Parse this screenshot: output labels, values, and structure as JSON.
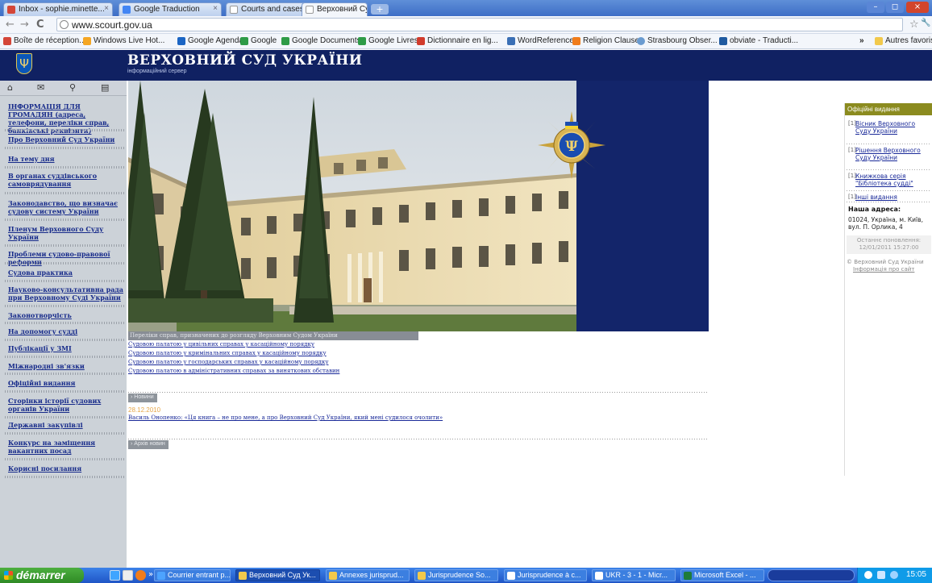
{
  "browser": {
    "tabs": [
      {
        "title": "Inbox - sophie.minette...",
        "icon_color": "#d44638",
        "icon": "gmail-icon"
      },
      {
        "title": "Google Traduction",
        "icon_color": "#4285f4",
        "icon": "translate-icon"
      },
      {
        "title": "Courts and cases Ukrai...",
        "icon_color": "#ffffff",
        "icon": "page-icon"
      },
      {
        "title": "Верховний Суд України",
        "icon_color": "#ffffff",
        "icon": "page-icon"
      }
    ],
    "close_glyph": "×",
    "newtab_glyph": "+",
    "window_buttons": {
      "minimize": "–",
      "maximize": "◻",
      "close": "×"
    },
    "nav": {
      "back": "←",
      "forward": "→",
      "reload": "C"
    },
    "url": "www.scourt.gov.ua",
    "star": "☆",
    "wrench": "🔧",
    "bookmarks": [
      {
        "label": "Boîte de réception...",
        "icon_color": "#d44638"
      },
      {
        "label": "Windows Live Hot...",
        "icon_color": "#f5a623"
      },
      {
        "label": "Google Agenda",
        "icon_color": "#1b65c4"
      },
      {
        "label": "Google",
        "icon_color": "#2e9b47"
      },
      {
        "label": "Google Documents",
        "icon_color": "#2e9b47"
      },
      {
        "label": "Google Livres",
        "icon_color": "#2e9b47"
      },
      {
        "label": "Dictionnaire en lig...",
        "icon_color": "#d13b2c"
      },
      {
        "label": "WordReference",
        "icon_color": "#3a6fb5"
      },
      {
        "label": "Religion Clause",
        "icon_color": "#f07c1b"
      },
      {
        "label": "Strasbourg Obser...",
        "icon_color": "#6a9bd0"
      },
      {
        "label": "obviate - Traducti...",
        "icon_color": "#1f5aa0"
      }
    ],
    "bookmarks_more": "»",
    "other_bookmarks": "Autres favoris"
  },
  "site": {
    "title": "ВЕРХОВНИЙ СУД УКРАЇНИ",
    "subtitle": "інформаційний сервер",
    "quick_icons": [
      "⌂",
      "✉",
      "⚲",
      "▤"
    ],
    "nav": [
      "ІНФОРМАЦІЯ ДЛЯ ГРОМАДЯН (адреса, телефони, переліки справ, банківські реквізити)",
      "Про Верховний Суд України",
      "На тему дня",
      "В органах суддівського самоврядування",
      "Законодавство, що визначає судову систему України",
      "Пленум Верховного Суду України",
      "Проблеми судово-правової реформи",
      "Судова практика",
      "Науково-консультативна рада при Верховному Суді України",
      "Законотворчість",
      "На допомогу судді",
      "Публікації у ЗМІ",
      "Міжнародні зв'язки",
      "Офіційні видання",
      "Сторінки історії судових органів України",
      "Державні закупівлі",
      "Конкурс на заміщення вакантних посад",
      "Корисні посилання"
    ],
    "cases_header": "Переліки справ, призначених до розгляду Верховним Судом України",
    "cases": [
      "Судовою палатою у цивільних справах у касаційному порядку",
      "Судовою палатою у кримінальних справах у касаційному порядку",
      "Судовою палатою у господарських справах у касаційному порядку",
      "Судовою палатою в адміністративних справах за виняткових обставин"
    ],
    "news_label": "› Новини",
    "news_date": "28.12.2010",
    "news_title": "Василь Онопенко: «Ця книга – не про мене, а про Верховний Суд України, який мені судилося очолити»",
    "archive_label": "› Архів новин",
    "right": {
      "header": "Офіційні видання",
      "pubs": [
        {
          "num": "[1]",
          "text": "Вісник Верховного Суду України"
        },
        {
          "num": "[1]",
          "text": "Рішення Верховного Суду України"
        },
        {
          "num": "[1]",
          "text": "Книжкова серія \"Бібліотека судді\""
        },
        {
          "num": "[1]",
          "text": "Інші видання"
        }
      ],
      "address_head": "Наша адреса:",
      "address": "01024, Україна, м. Київ, вул. П. Орлика, 4",
      "updated": "Останнє поновлення: 12/01/2011 15:27:00",
      "copyright": "© Верховний Суд України",
      "about": "Інформація про сайт"
    }
  },
  "taskbar": {
    "start": "démarrer",
    "tasks": [
      {
        "label": "Courrier entrant p...",
        "icon_color": "#4da3ff"
      },
      {
        "label": "Верховний Суд Ук...",
        "icon_color": "#f2c94c"
      },
      {
        "label": "Annexes jurisprud...",
        "icon_color": "#f2c94c"
      },
      {
        "label": "Jurisprudence So...",
        "icon_color": "#f2c94c"
      },
      {
        "label": "Jurisprudence à c...",
        "icon_color": "#ffffff"
      },
      {
        "label": "UKR - 3 - 1 - Micr...",
        "icon_color": "#ffffff"
      },
      {
        "label": "Microsoft Excel - ...",
        "icon_color": "#1e7b3a"
      }
    ],
    "clock": "15:05"
  }
}
